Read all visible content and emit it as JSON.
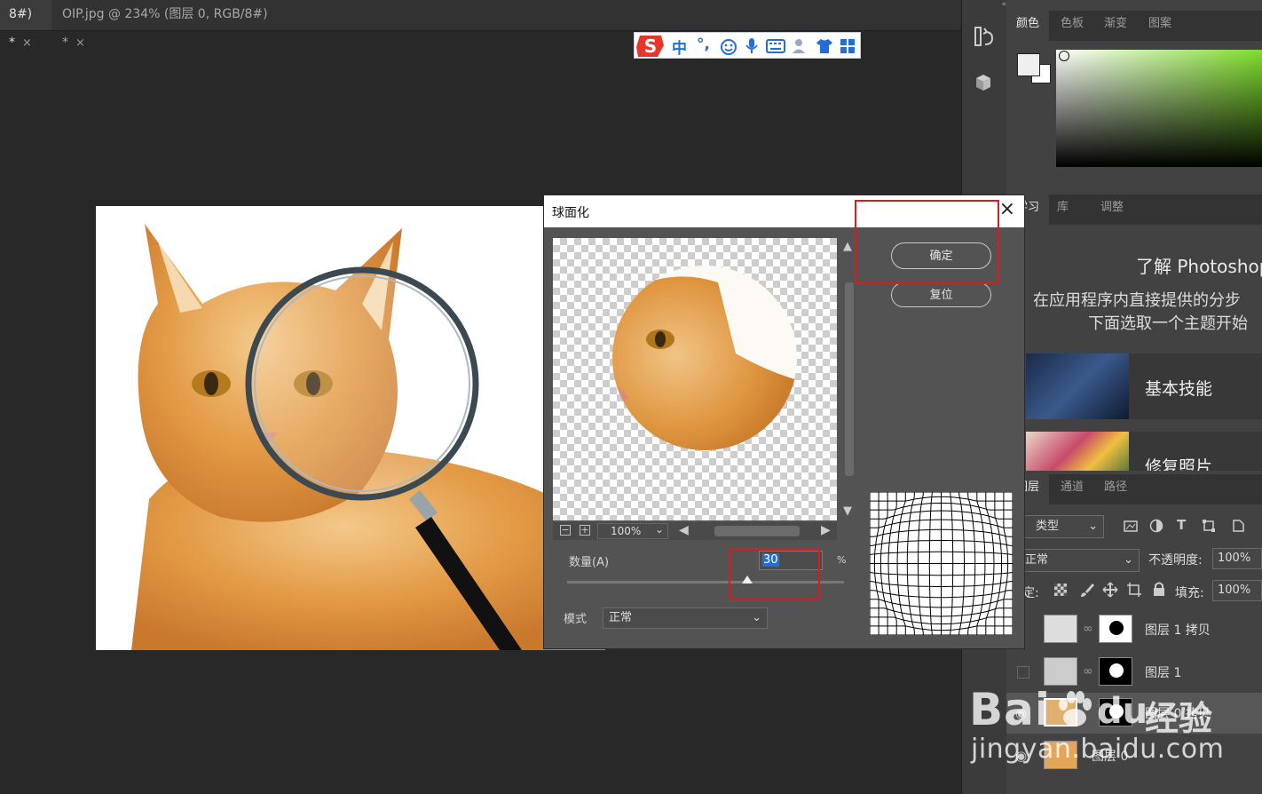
{
  "tabs": [
    {
      "label": "8#) *",
      "close": "×"
    },
    {
      "label": "OIP.jpg @ 234% (图层 0, RGB/8#) *",
      "close": "×"
    }
  ],
  "ime": {
    "logo": "S",
    "items": [
      "中",
      "°,"
    ]
  },
  "dialog": {
    "title": "球面化",
    "close": "×",
    "ok_label": "确定",
    "reset_label": "复位",
    "zoom_value": "100%",
    "amount_label": "数量(A)",
    "amount_value": "30",
    "amount_unit": "%",
    "amount_fraction": 0.65,
    "mode_label": "模式",
    "mode_value": "正常"
  },
  "color_panel": {
    "tabs": [
      "颜色",
      "色板",
      "渐变",
      "图案"
    ]
  },
  "learn_panel": {
    "tabs": [
      "学习",
      "库",
      "调整"
    ],
    "title": "了解 Photoshop",
    "desc_line1": "在应用程序内直接提供的分步",
    "desc_line2": "下面选取一个主题开始",
    "topics": [
      "基本技能",
      "修复照片"
    ]
  },
  "layers_panel": {
    "tabs": [
      "图层",
      "通道",
      "路径"
    ],
    "filter_label": "类型",
    "blend_mode": "正常",
    "opacity_label": "不透明度:",
    "opacity_value": "100%",
    "lock_label": "锁定:",
    "fill_label": "填充:",
    "fill_value": "100%",
    "layers": [
      {
        "name": "图层 1 拷贝"
      },
      {
        "name": "图层 1"
      },
      {
        "name": "图层 0 拷贝"
      },
      {
        "name": "图层 0"
      }
    ]
  },
  "watermark": {
    "brand": "Bai",
    "paw": "du",
    "jingyan": "经验",
    "url": "jingyan.baidu.com"
  },
  "colors": {
    "accent_red": "#e0191c",
    "selection_blue": "#1f6fd6"
  }
}
